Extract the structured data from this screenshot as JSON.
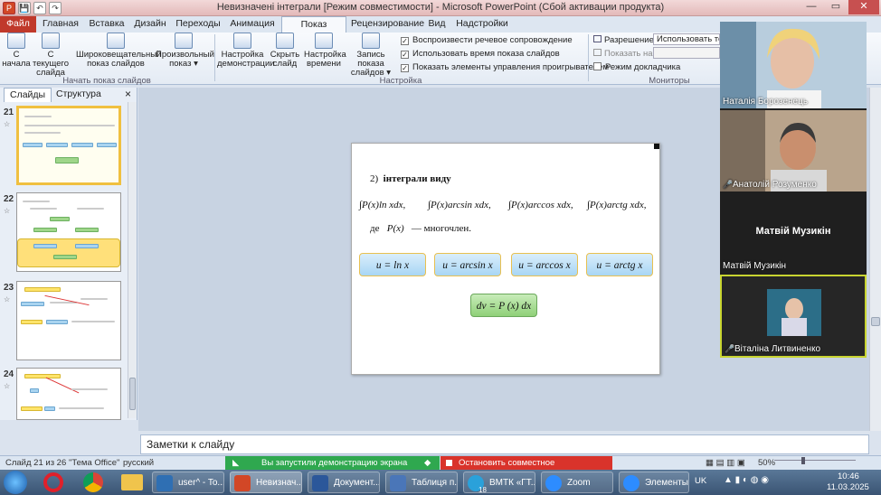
{
  "window": {
    "title": "Невизначені інтеграли [Режим совместимости] - Microsoft PowerPoint (Сбой активации продукта)",
    "qat_save": "💾",
    "qat_undo": "↶",
    "qat_redo": "↷",
    "min": "—",
    "max": "▭",
    "close": "✕"
  },
  "tabs": [
    "Главная",
    "Вставка",
    "Дизайн",
    "Переходы",
    "Анимация",
    "Показ слайдов",
    "Рецензирование",
    "Вид",
    "Надстройки"
  ],
  "file_tab": "Файл",
  "ribbon": {
    "start_group": {
      "label": "Начать показ слайдов",
      "buttons": [
        {
          "l1": "С",
          "l2": "начала"
        },
        {
          "l1": "С текущего",
          "l2": "слайда"
        },
        {
          "l1": "Широковещательный",
          "l2": "показ слайдов"
        },
        {
          "l1": "Произвольный",
          "l2": "показ ▾"
        }
      ]
    },
    "setup_group": {
      "label": "Настройка",
      "buttons": [
        {
          "l1": "Настройка",
          "l2": "демонстрации"
        },
        {
          "l1": "Скрыть",
          "l2": "слайд"
        },
        {
          "l1": "Настройка",
          "l2": "времени"
        },
        {
          "l1": "Запись показа",
          "l2": "слайдов ▾"
        }
      ],
      "checks": [
        {
          "label": "Воспроизвести речевое сопровождение",
          "mark": "✓"
        },
        {
          "label": "Использовать время показа слайдов",
          "mark": "✓"
        },
        {
          "label": "Показать элементы управления проигрывателем",
          "mark": "✓"
        }
      ]
    },
    "monitors_group": {
      "label": "Мониторы",
      "resolution_label": "Разрешение:",
      "resolution_value": "Использовать текущ",
      "show_on_label": "Показать на:",
      "presenter_view": "Режим докладчика"
    }
  },
  "left_panel": {
    "tab_slides": "Слайды",
    "tab_outline": "Структура",
    "close": "×",
    "thumbnails": [
      {
        "num": "21",
        "star": "☆"
      },
      {
        "num": "22",
        "star": "☆"
      },
      {
        "num": "23",
        "star": "☆"
      },
      {
        "num": "24",
        "star": "☆"
      }
    ]
  },
  "slide": {
    "heading_num": "2)",
    "heading_text": "інтеграли виду",
    "integrals": [
      "∫P(x)ln xdx,",
      "∫P(x)arcsin xdx,",
      "∫P(x)arccos xdx,",
      "∫P(x)arctg xdx,"
    ],
    "where": "де",
    "poly": "P(x)",
    "poly_desc": "— многочлен.",
    "boxes": [
      "u = ln x",
      "u = arcsin x",
      "u = arccos x",
      "u = arctg  x"
    ],
    "dv": "dv = P (x) dx"
  },
  "video": {
    "participants": [
      {
        "name": "Наталія Борозенець",
        "muted": false
      },
      {
        "name": "Анатолій Розуменко",
        "muted": true
      },
      {
        "name": "Матвій Музикін",
        "muted": false,
        "center": "Матвій Музикін"
      },
      {
        "name": "Віталіна Литвиненко",
        "muted": true
      }
    ],
    "mute_icon": "🎤"
  },
  "notes_placeholder": "Заметки к слайду",
  "status": {
    "slide_info": "Слайд 21 из 26",
    "theme": "\"Тема Office\"",
    "language": "русский",
    "share_started": "Вы запустили демонстрацию экрана",
    "stop_share": "Остановить совместное использование",
    "zoom": "50%"
  },
  "taskbar": {
    "items": [
      {
        "label": "user^ - To...",
        "color": "#2f6fb3"
      },
      {
        "label": "Невизнач...",
        "color": "#d24726"
      },
      {
        "label": "Документ...",
        "color": "#2b579a"
      },
      {
        "label": "Таблиця п...",
        "color": "#4a76b8"
      },
      {
        "label": "ВМТК «ГТ...",
        "color": "#2aa1da"
      },
      {
        "label": "Zoom",
        "color": "#2d8cff"
      },
      {
        "label": "Элементы...",
        "color": "#2d8cff"
      }
    ],
    "badge": "18",
    "lang": "UK",
    "time": "10:46",
    "date": "11.03.2025"
  }
}
